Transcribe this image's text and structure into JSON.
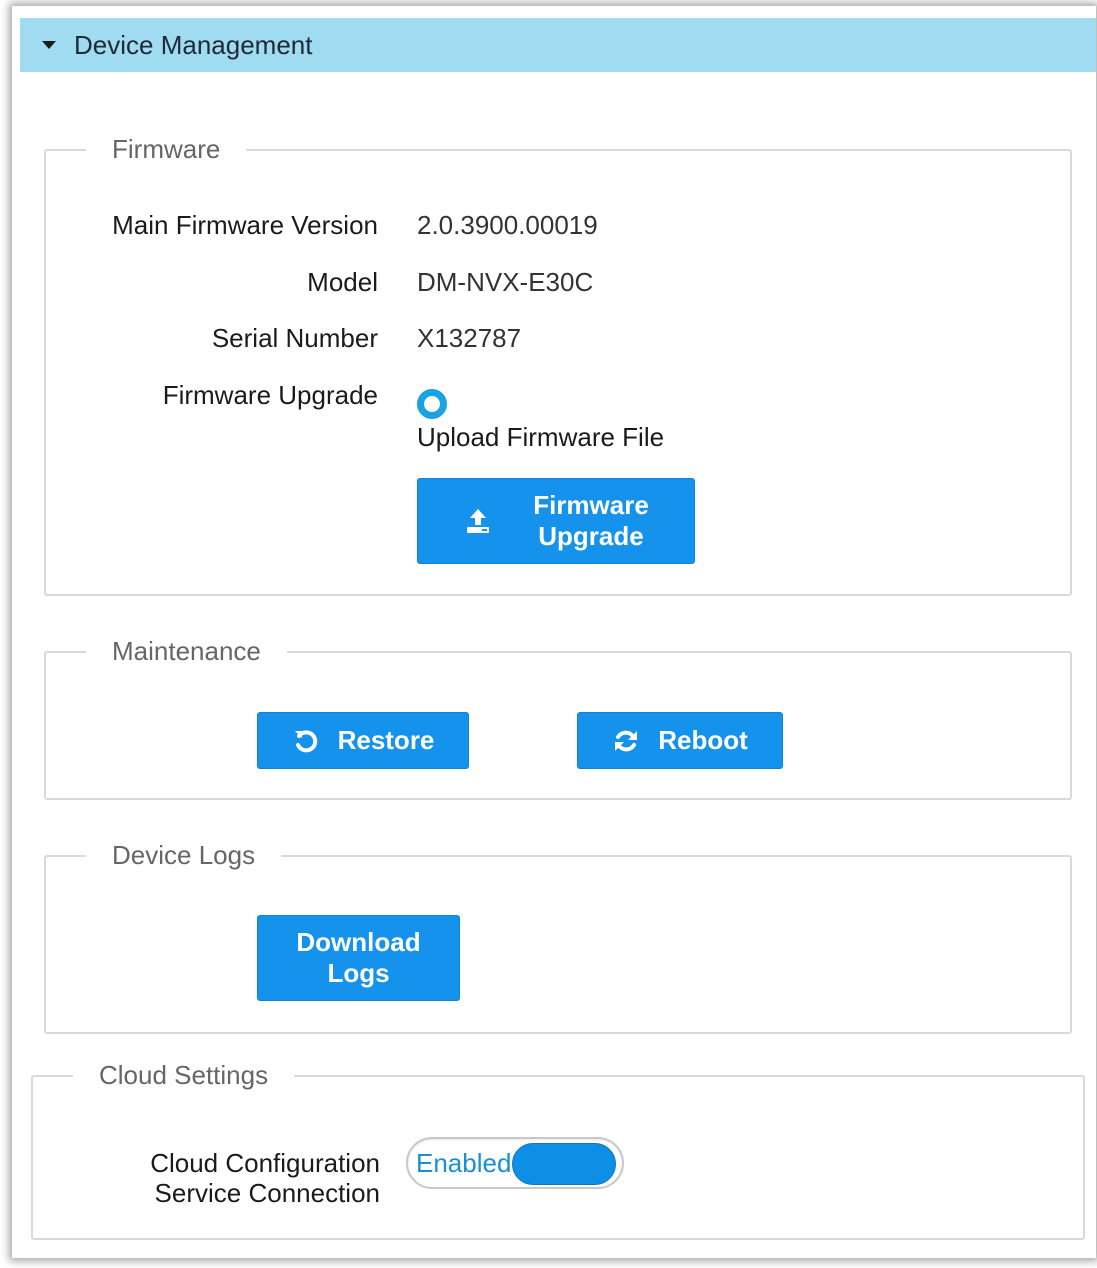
{
  "panel": {
    "title": "Device Management"
  },
  "firmware": {
    "legend": "Firmware",
    "rows": [
      {
        "label": "Main Firmware Version",
        "value": "2.0.3900.00019"
      },
      {
        "label": "Model",
        "value": "DM-NVX-E30C"
      },
      {
        "label": "Serial Number",
        "value": "X132787"
      }
    ],
    "upgrade_label": "Firmware Upgrade",
    "upload_option": "Upload Firmware File",
    "upgrade_button": {
      "line1": "Firmware",
      "line2": "Upgrade",
      "icon": "upload-icon"
    }
  },
  "maintenance": {
    "legend": "Maintenance",
    "restore_button": {
      "label": "Restore",
      "icon": "undo-icon"
    },
    "reboot_button": {
      "label": "Reboot",
      "icon": "refresh-icon"
    }
  },
  "logs": {
    "legend": "Device Logs",
    "download_button": {
      "line1": "Download",
      "line2": "Logs"
    }
  },
  "cloud": {
    "legend": "Cloud Settings",
    "label_line1": "Cloud Configuration",
    "label_line2": "Service Connection",
    "toggle_state": "Enabled"
  },
  "colors": {
    "header_bg": "#9fdcf2",
    "button_bg": "#1592ec",
    "toggle_text": "#1a8fd4"
  }
}
